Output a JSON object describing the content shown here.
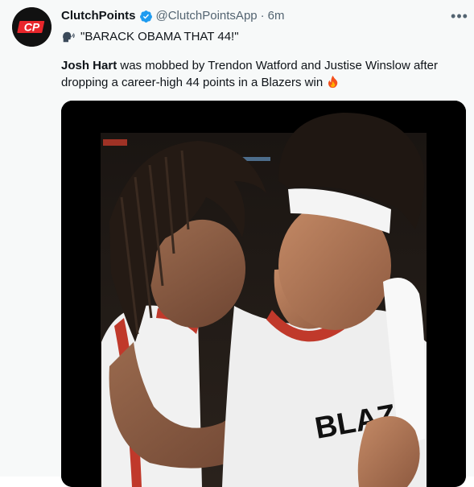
{
  "account": {
    "display_name": "ClutchPoints",
    "handle": "@ClutchPointsApp",
    "separator": "·",
    "time": "6m",
    "avatar_logo_text": "CP"
  },
  "tweet": {
    "quote_text": "\"BARACK OBAMA THAT 44!\"",
    "body_bold": "Josh Hart",
    "body_rest": " was mobbed by Trendon Watford and Justise Winslow after dropping a career-high 44 points in a Blazers win "
  },
  "icons": {
    "verified": "verified-badge-icon",
    "more": "more-options-icon",
    "speaking": "speaking-head-icon",
    "fire": "fire-icon"
  },
  "colors": {
    "verified_blue": "#1d9bf0",
    "secondary_text": "#536471",
    "background": "#f7f9f9",
    "logo_red": "#e8262b"
  },
  "media": {
    "jersey_text": "BLAZ"
  }
}
